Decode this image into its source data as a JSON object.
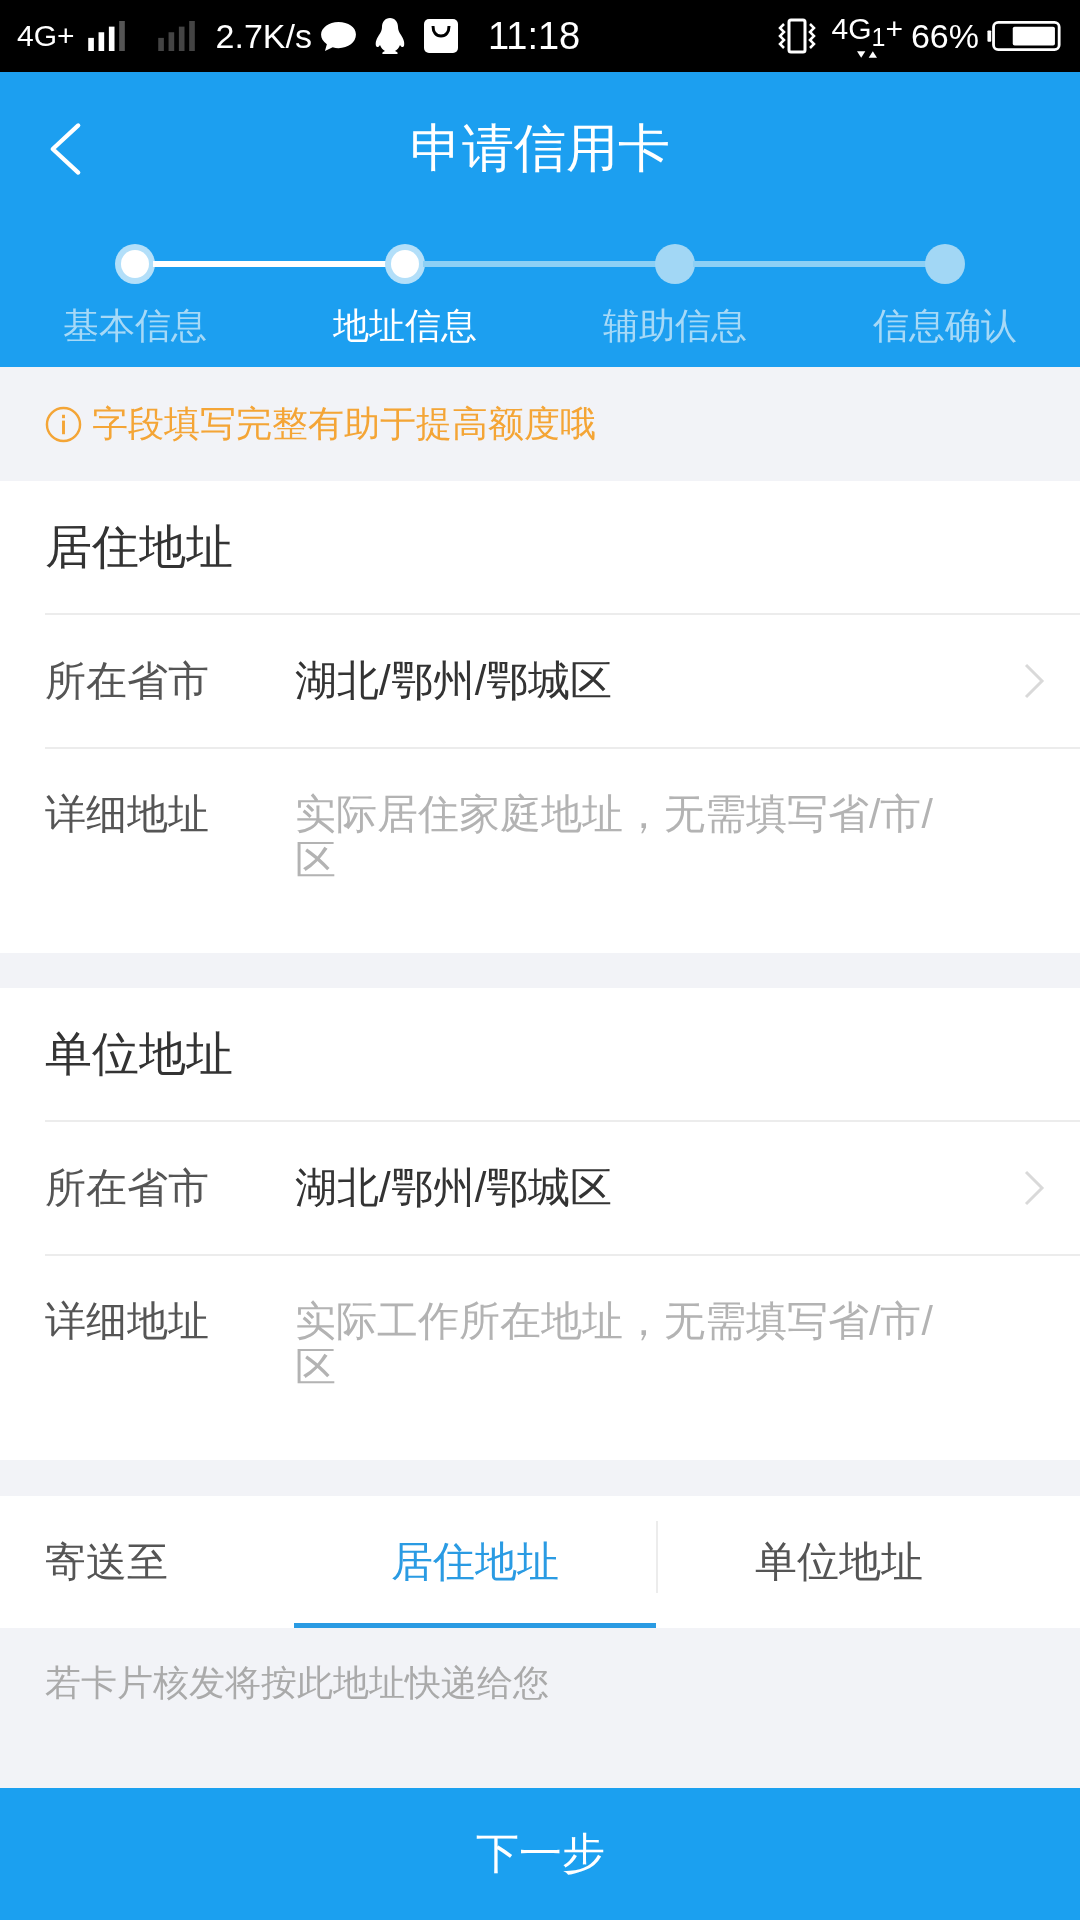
{
  "status_bar": {
    "network": "4G+",
    "speed": "2.7K/s",
    "time": "11:18",
    "network_2": "4G$_{1}$+",
    "battery": "66%"
  },
  "header": {
    "title": "申请信用卡"
  },
  "steps": [
    {
      "label": "基本信息",
      "reached": true,
      "selected": false
    },
    {
      "label": "地址信息",
      "reached": true,
      "selected": true
    },
    {
      "label": "辅助信息",
      "reached": false,
      "selected": false
    },
    {
      "label": "信息确认",
      "reached": false,
      "selected": false
    }
  ],
  "notice": {
    "text": "字段填写完整有助于提高额度哦"
  },
  "sections": [
    {
      "title": "居住地址",
      "fields": [
        {
          "kind": "select",
          "label": "所在省市",
          "value": "湖北/鄂州/鄂城区"
        },
        {
          "kind": "text",
          "label": "详细地址",
          "placeholder": "实际居住家庭地址，无需填写省/市/区"
        }
      ]
    },
    {
      "title": "单位地址",
      "fields": [
        {
          "kind": "select",
          "label": "所在省市",
          "value": "湖北/鄂州/鄂城区"
        },
        {
          "kind": "text",
          "label": "详细地址",
          "placeholder": "实际工作所在地址，无需填写省/市/区"
        }
      ]
    }
  ],
  "delivery": {
    "label": "寄送至",
    "options": [
      {
        "label": "居住地址",
        "selected": true
      },
      {
        "label": "单位地址",
        "selected": false
      }
    ],
    "note": "若卡片核发将按此地址快递给您"
  },
  "next_button": {
    "label": "下一步"
  }
}
